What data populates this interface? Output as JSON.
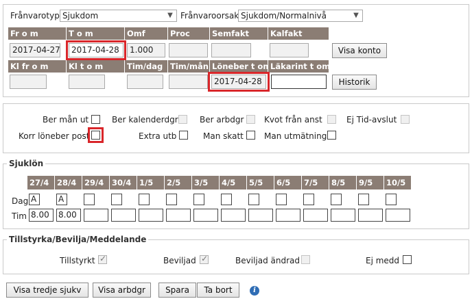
{
  "top": {
    "franvarotyp_label": "Frånvarotyp",
    "franvarotyp_value": "Sjukdom",
    "franvaroorsak_label": "Frånvaroorsak",
    "franvaroorsak_value": "Sjukdom/Normalnivå"
  },
  "row1": {
    "headers": [
      "Fr o m",
      "T o m",
      "Omf",
      "Proc",
      "Semfakt",
      "Kalfakt"
    ],
    "from": "2017-04-27",
    "tom": "2017-04-28",
    "omf": "1.000",
    "proc": "",
    "semfakt": "",
    "kalfakt": "",
    "visa_konto": "Visa konto"
  },
  "row2": {
    "headers": [
      "Kl fr o m",
      "Kl t o m",
      "Tim/dag",
      "Tim/mån",
      "Löneber t om",
      "Läkarint t om"
    ],
    "kl_from": "",
    "kl_tom": "",
    "tim_dag": "",
    "tim_man": "",
    "loneber_tom": "2017-04-28",
    "lakarint_tom": "",
    "historik": "Historik"
  },
  "options": {
    "ber_man_ut": "Ber mån ut",
    "ber_kalenderdgr": "Ber kalenderdgr",
    "ber_arbdgr": "Ber arbdgr",
    "kvot_fran_anst": "Kvot från anst",
    "ej_tid_avslut": "Ej Tid-avslut",
    "korr_loneber_post": "Korr löneber post",
    "extra_utb": "Extra utb",
    "man_skatt": "Man skatt",
    "man_utmatning": "Man utmätning"
  },
  "sjuklon": {
    "title": "Sjuklön",
    "dag_label": "Dag",
    "tim_label": "Tim",
    "days": [
      "27/4",
      "28/4",
      "29/4",
      "30/4",
      "1/5",
      "2/5",
      "3/5",
      "4/5",
      "5/5",
      "6/5",
      "7/5",
      "8/5",
      "9/5",
      "10/5"
    ],
    "dag_values": [
      "A",
      "A",
      "",
      "",
      "",
      "",
      "",
      "",
      "",
      "",
      "",
      "",
      "",
      ""
    ],
    "tim_values": [
      "8.00",
      "8.00",
      "",
      "",
      "",
      "",
      "",
      "",
      "",
      "",
      "",
      "",
      "",
      ""
    ]
  },
  "tillstyrka": {
    "title": "Tillstyrka/Bevilja/Meddelande",
    "tillstyrkt": "Tillstyrkt",
    "beviljad": "Beviljad",
    "beviljad_andrad": "Beviljad ändrad",
    "ej_medd": "Ej medd"
  },
  "buttons": {
    "visa_tredje_sjukv": "Visa tredje sjukv",
    "visa_arbdgr": "Visa arbdgr",
    "spara": "Spara",
    "ta_bort": "Ta bort"
  },
  "colors": {
    "header_bg": "#8b7d74",
    "highlight_red": "#d9262a",
    "info_blue": "#2f6db5"
  }
}
